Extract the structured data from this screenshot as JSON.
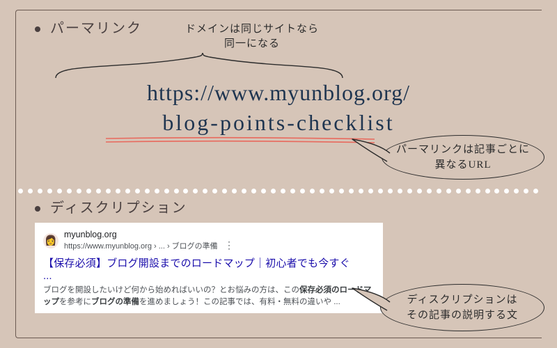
{
  "headings": {
    "permalink": "パーマリンク",
    "description": "ディスクリプション"
  },
  "domain_note": {
    "line1": "ドメインは同じサイトなら",
    "line2": "同一になる"
  },
  "url": {
    "domain": "https://www.myunblog.org/",
    "slug": "blog-points-checklist"
  },
  "bubble_permalink": {
    "line1": "パーマリンクは記事ごとに",
    "line2": "異なるURL"
  },
  "bubble_description": {
    "line1": "ディスクリプションは",
    "line2": "その記事の説明する文"
  },
  "serp": {
    "site": "myunblog.org",
    "breadcrumb": "https://www.myunblog.org › ... › ブログの準備",
    "menu_icon": "⋮",
    "title": "【保存必須】ブログ開設までのロードマップ｜初心者でも今すぐ",
    "title_ellipsis": "...",
    "desc_plain1": "ブログを開設したいけど何から始めればいいの？とお悩みの方は、この",
    "desc_bold1": "保存必須のロードマップ",
    "desc_plain2": "を参考に",
    "desc_bold2": "ブログの準備",
    "desc_plain3": "を進めましょう！この記事では、有料・無料の違いや ...",
    "favicon_emoji": "👩"
  }
}
